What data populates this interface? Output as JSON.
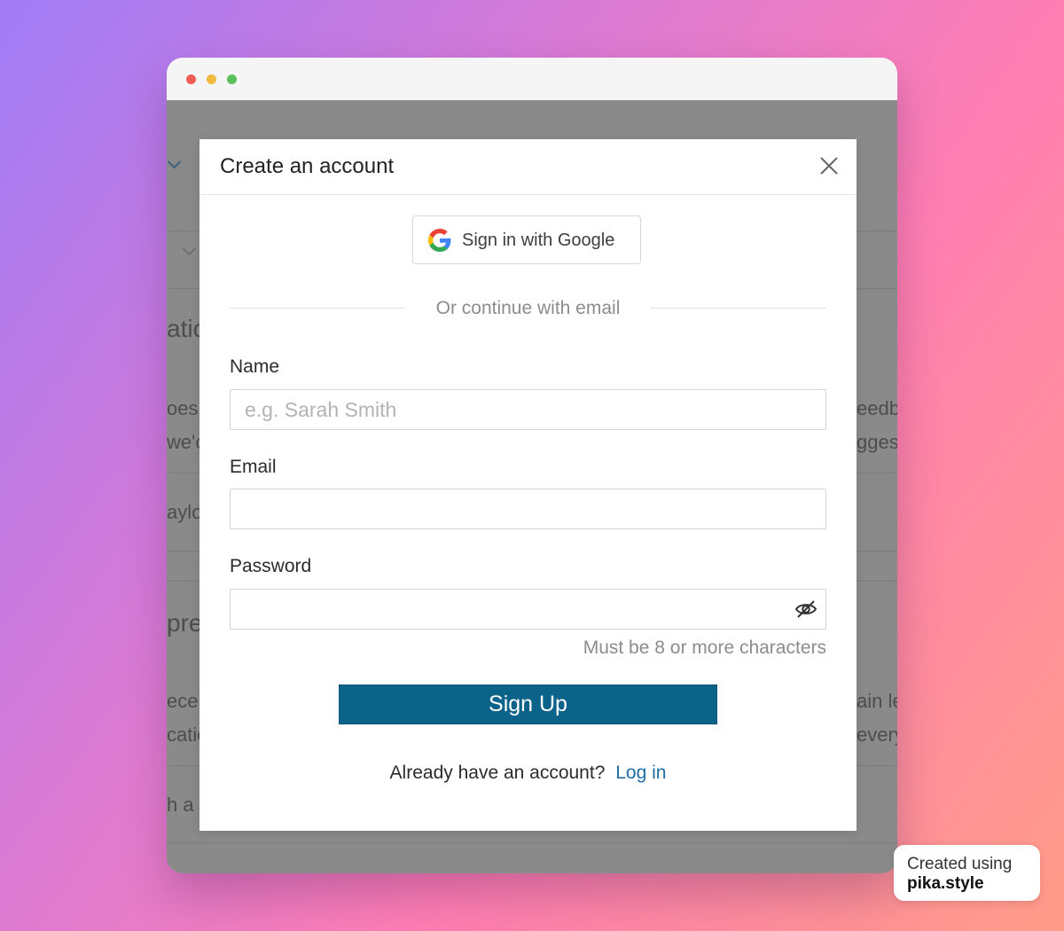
{
  "background_page": {
    "fragments": {
      "f1": "atic",
      "f2": "oes",
      "f3": "we'c",
      "f4": "ayloi",
      "f5": "pre",
      "f6": "eceiv",
      "f7": "catio",
      "f8": "h  a",
      "r1": "eedb",
      "r2": "ggest",
      "r3": "ain le",
      "r4": "every"
    }
  },
  "modal": {
    "title": "Create an account",
    "close_icon": "close-icon",
    "google_button": {
      "label": "Sign in with Google",
      "icon": "google-g-icon"
    },
    "divider_text": "Or continue with email",
    "fields": {
      "name": {
        "label": "Name",
        "placeholder": "e.g. Sarah Smith",
        "value": ""
      },
      "email": {
        "label": "Email",
        "placeholder": "",
        "value": ""
      },
      "password": {
        "label": "Password",
        "value": "",
        "hint": "Must be 8 or more characters",
        "toggle_icon": "eye-slash-icon"
      }
    },
    "submit_label": "Sign Up",
    "footer": {
      "question": "Already have an account?",
      "link_label": "Log in"
    }
  },
  "badge": {
    "line1": "Created using",
    "line2": "pika.style"
  },
  "colors": {
    "primary_button": "#0b6389",
    "link": "#1c6ea4",
    "overlay": "#8a8a8a"
  }
}
